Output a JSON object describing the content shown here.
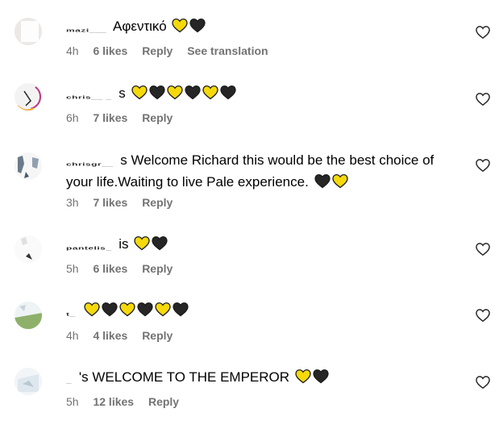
{
  "comments": [
    {
      "username": "mazi___",
      "text": "Αφεντικό",
      "hearts": [
        "yellow",
        "black"
      ],
      "time": "4h",
      "likes": "6 likes",
      "reply": "Reply",
      "translate": "See translation"
    },
    {
      "username": "chris__ _ ",
      "text": "s",
      "hearts": [
        "yellow",
        "black",
        "yellow",
        "black",
        "yellow",
        "black"
      ],
      "time": "6h",
      "likes": "7 likes",
      "reply": "Reply"
    },
    {
      "username": "chrisgr__",
      "text": "s Welcome Richard this would be the best choice of your life.Waiting to live Pale experience.",
      "hearts": [
        "black",
        "yellow"
      ],
      "time": "3h",
      "likes": "7 likes",
      "reply": "Reply"
    },
    {
      "username": "pantelis_",
      "text": "is",
      "hearts": [
        "yellow",
        "black"
      ],
      "time": "5h",
      "likes": "6 likes",
      "reply": "Reply"
    },
    {
      "username": "t_",
      "text": "",
      "hearts": [
        "yellow",
        "black",
        "yellow",
        "black",
        "yellow",
        "black"
      ],
      "time": "4h",
      "likes": "4 likes",
      "reply": "Reply"
    },
    {
      "username": "_",
      "text": "'s WELCOME TO THE EMPEROR",
      "hearts": [
        "yellow",
        "black"
      ],
      "time": "5h",
      "likes": "12 likes",
      "reply": "Reply"
    }
  ],
  "colors": {
    "yellow_heart": "#f5d90a",
    "black_heart": "#262626",
    "meta_text": "#737373"
  },
  "icons": {
    "like": "heart-outline-icon"
  }
}
